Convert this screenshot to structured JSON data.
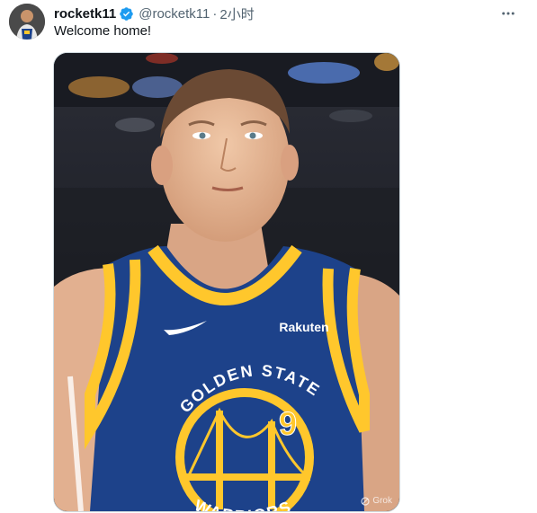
{
  "tweet": {
    "display_name": "rocketk11",
    "handle": "@rocketk11",
    "separator": "·",
    "timestamp": "2小时",
    "text": "Welcome home!",
    "verified": true
  },
  "media": {
    "jersey_team_text": "GOLDEN STATE",
    "jersey_bottom_text": "WARRIORS",
    "jersey_number": "9",
    "jersey_sponsor": "Rakuten",
    "watermark": "Grok"
  },
  "colors": {
    "verified_blue": "#1d9bf0",
    "warriors_blue": "#1d428a",
    "warriors_gold": "#ffc72c",
    "text_secondary": "#536471"
  },
  "icons": {
    "verified": "verified-badge-icon",
    "more": "more-horizontal-icon",
    "watermark": "grok-logo-icon"
  }
}
